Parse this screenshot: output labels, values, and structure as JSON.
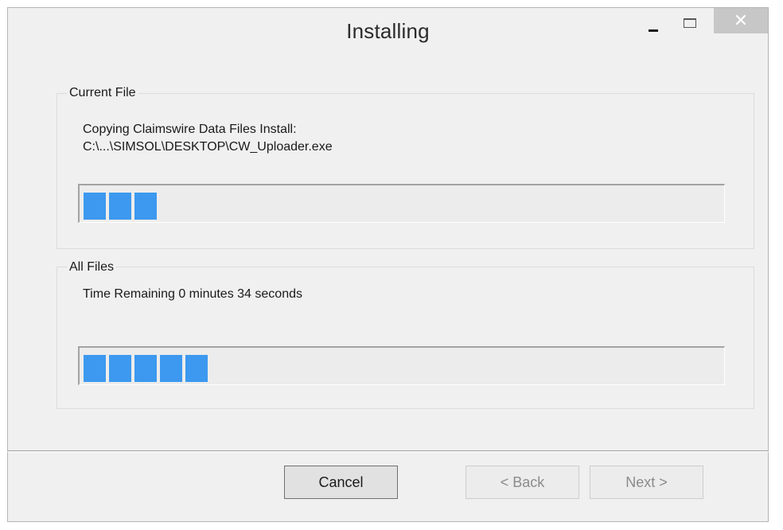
{
  "window": {
    "title": "Installing",
    "controls": {
      "minimize_icon": "minimize-icon",
      "maximize_icon": "maximize-icon",
      "close_glyph": "✕"
    }
  },
  "current_file": {
    "legend": "Current File",
    "line1": "Copying Claimswire Data Files Install:",
    "line2": "C:\\...\\SIMSOL\\DESKTOP\\CW_Uploader.exe",
    "progress_fraction": 0.12
  },
  "all_files": {
    "legend": "All Files",
    "time_remaining": "Time Remaining 0 minutes 34 seconds",
    "progress_fraction": 0.2
  },
  "buttons": {
    "cancel": "Cancel",
    "back": "< Back",
    "next": "Next >"
  },
  "colors": {
    "progress": "#3c99ef",
    "window_bg": "#f0f0f0"
  }
}
